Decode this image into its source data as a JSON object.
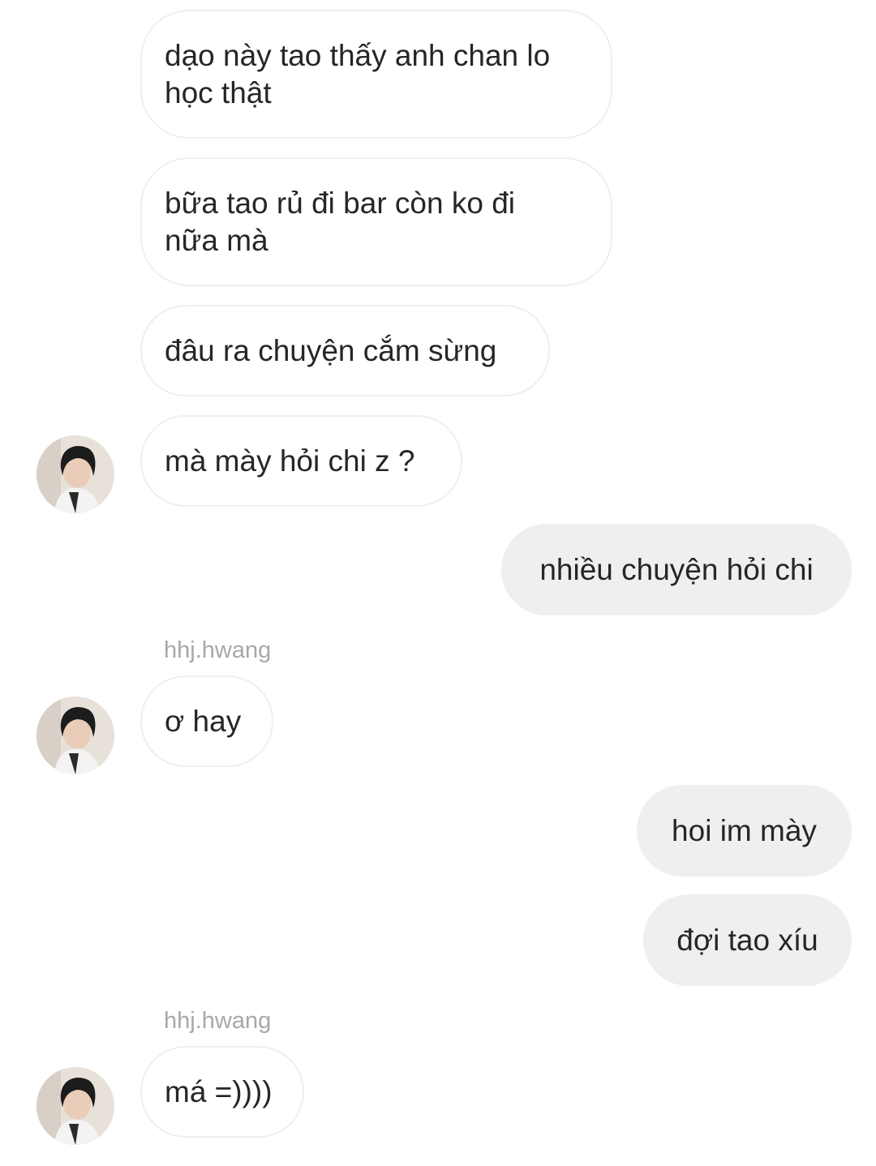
{
  "messages": [
    {
      "direction": "incoming",
      "text": "dạo này tao thấy anh chan lo\nhọc thật"
    },
    {
      "direction": "incoming",
      "text": "bữa tao rủ đi bar còn ko đi\nnữa mà"
    },
    {
      "direction": "incoming",
      "text": "đâu ra chuyện cắm sừng"
    },
    {
      "direction": "incoming",
      "text": "mà mày hỏi chi z ?"
    },
    {
      "direction": "outgoing",
      "text": "nhiều chuyện hỏi chi"
    },
    {
      "direction": "incoming",
      "sender": "hhj.hwang",
      "text": "ơ hay"
    },
    {
      "direction": "outgoing",
      "text": "hoi im mày"
    },
    {
      "direction": "outgoing",
      "text": "đợi tao xíu"
    },
    {
      "direction": "incoming",
      "sender": "hhj.hwang",
      "text": "má =))))"
    }
  ],
  "colors": {
    "incoming_bubble_border": "#efefef",
    "outgoing_bubble_bg": "#efefef",
    "text": "#262626",
    "sender_name": "#a8a8a8"
  },
  "icons": {
    "contact_avatar": "profile-photo"
  }
}
